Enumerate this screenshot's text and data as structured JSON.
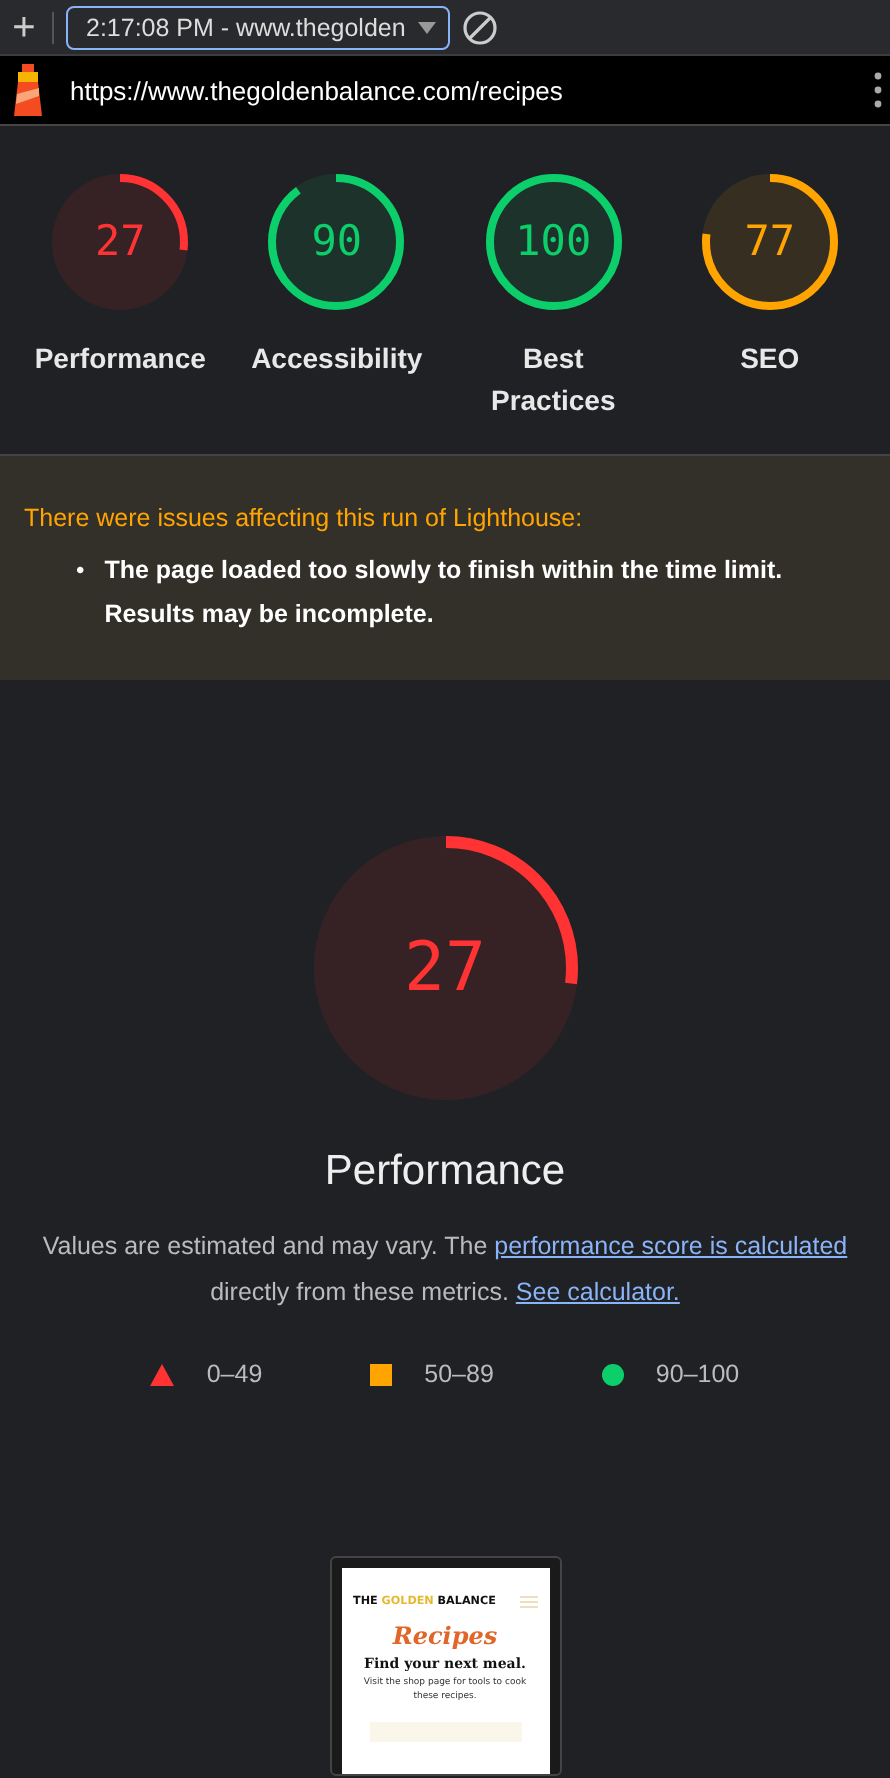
{
  "toolbar": {
    "add_icon": "+",
    "session": "2:17:08 PM - www.thegolden"
  },
  "url_bar": {
    "url": "https://www.thegoldenbalance.com/recipes"
  },
  "gauges": [
    {
      "score": "27",
      "label": "Performance",
      "level": 0.27,
      "color": "#ff3333"
    },
    {
      "score": "90",
      "label": "Accessibility",
      "level": 0.9,
      "color": "#0cce6b"
    },
    {
      "score": "100",
      "label": "Best Practices",
      "level": 1,
      "color": "#0cce6b"
    },
    {
      "score": "77",
      "label": "SEO",
      "level": 0.77,
      "color": "#ffa400"
    }
  ],
  "warning": {
    "title": "There were issues affecting this run of Lighthouse:",
    "items": [
      {
        "marker": "•",
        "text": "The page loaded too slowly to finish within the time limit. Results may be incomplete."
      }
    ]
  },
  "main_gauge": {
    "score": "27",
    "label": "Performance",
    "level": 0.27,
    "color": "#ff3333"
  },
  "description": {
    "text": "Values are estimated and may vary. The",
    "link": "performance score is calculated",
    "text_2": "directly from these metrics.",
    "link_2": "See calculator."
  },
  "legend": [
    {
      "kind": "triangle",
      "color": "#ff3333",
      "range": "0–49"
    },
    {
      "kind": "square",
      "color": "#ffa400",
      "range": "50–89"
    },
    {
      "kind": "circle",
      "color": "#0cce6b",
      "range": "90–100"
    }
  ],
  "thumbnail": {
    "logo": [
      {
        "text": "THE ",
        "highlight": false
      },
      {
        "text": "GOLDEN",
        "highlight": true
      },
      {
        "text": " BALANCE",
        "highlight": false
      }
    ],
    "heading": "Recipes",
    "subheading": "Find your next meal.",
    "body": "Visit the shop page for tools to cook these recipes."
  }
}
